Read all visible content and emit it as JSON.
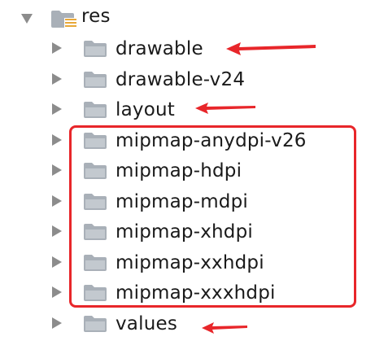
{
  "tree": {
    "root": {
      "label": "res",
      "icon": "resource-folder-icon",
      "state": "expanded"
    },
    "items": [
      {
        "label": "drawable",
        "icon": "folder-icon",
        "state": "collapsed",
        "annotated": "arrow"
      },
      {
        "label": "drawable-v24",
        "icon": "folder-icon",
        "state": "collapsed"
      },
      {
        "label": "layout",
        "icon": "folder-icon",
        "state": "collapsed",
        "annotated": "arrow"
      },
      {
        "label": "mipmap-anydpi-v26",
        "icon": "folder-icon",
        "state": "collapsed",
        "annotated": "box"
      },
      {
        "label": "mipmap-hdpi",
        "icon": "folder-icon",
        "state": "collapsed",
        "annotated": "box"
      },
      {
        "label": "mipmap-mdpi",
        "icon": "folder-icon",
        "state": "collapsed",
        "annotated": "box"
      },
      {
        "label": "mipmap-xhdpi",
        "icon": "folder-icon",
        "state": "collapsed",
        "annotated": "box"
      },
      {
        "label": "mipmap-xxhdpi",
        "icon": "folder-icon",
        "state": "collapsed",
        "annotated": "box"
      },
      {
        "label": "mipmap-xxxhdpi",
        "icon": "folder-icon",
        "state": "collapsed",
        "annotated": "box"
      },
      {
        "label": "values",
        "icon": "folder-icon",
        "state": "collapsed",
        "annotated": "arrow"
      }
    ]
  },
  "colors": {
    "annotation_red": "#e8262a",
    "toggle_gray": "#8c8c8c",
    "folder_gray": "#a9b0b8",
    "text": "#1a1a1a"
  }
}
